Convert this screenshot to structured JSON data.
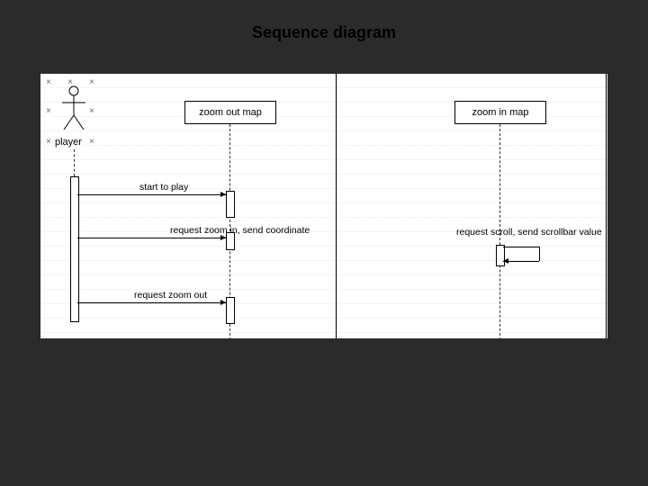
{
  "title": "Sequence diagram",
  "actor": {
    "label": "player"
  },
  "objects": {
    "zoom_out": "zoom out map",
    "zoom_in": "zoom in map"
  },
  "messages": {
    "m1": "start to play",
    "m2": "request zoom in, send coordinate",
    "m3": "request zoom out",
    "m4": "request scroll, send scrollbar value"
  }
}
